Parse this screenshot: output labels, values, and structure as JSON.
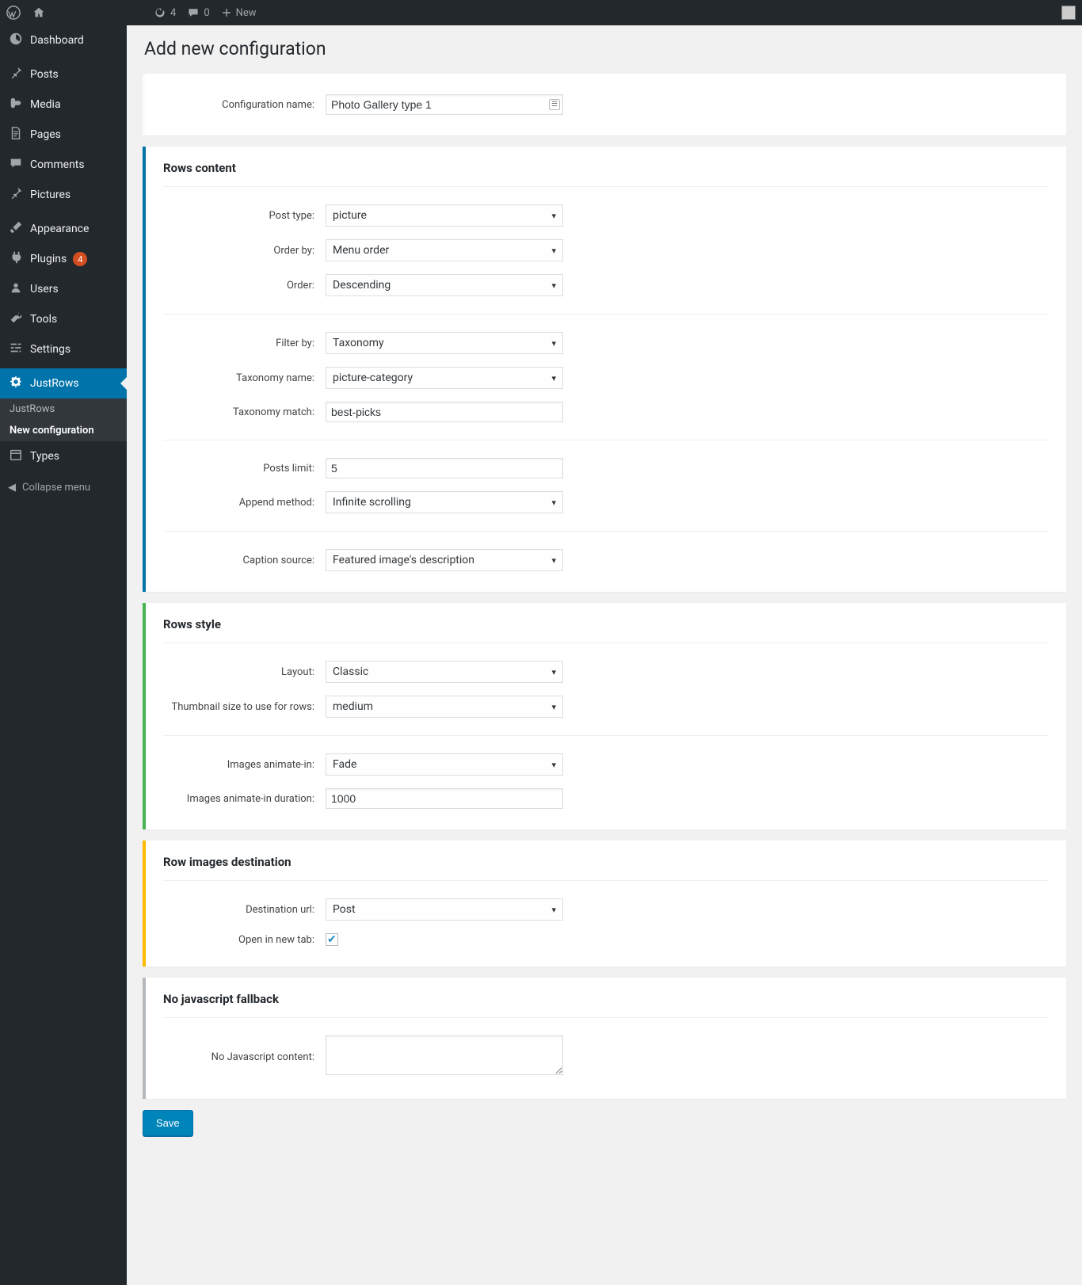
{
  "adminbar": {
    "updates_count": "4",
    "comments_count": "0",
    "new_label": "New"
  },
  "sidebar": {
    "items": [
      {
        "label": "Dashboard"
      },
      {
        "label": "Posts"
      },
      {
        "label": "Media"
      },
      {
        "label": "Pages"
      },
      {
        "label": "Comments"
      },
      {
        "label": "Pictures"
      },
      {
        "label": "Appearance"
      },
      {
        "label": "Plugins",
        "badge": "4"
      },
      {
        "label": "Users"
      },
      {
        "label": "Tools"
      },
      {
        "label": "Settings"
      },
      {
        "label": "JustRows"
      },
      {
        "label": "Types"
      }
    ],
    "submenu": {
      "justrows": "JustRows",
      "newconfig": "New configuration"
    },
    "collapse": "Collapse menu"
  },
  "page": {
    "title": "Add new configuration"
  },
  "config": {
    "name_label": "Configuration name:",
    "name_value": "Photo Gallery type 1"
  },
  "rows_content": {
    "heading": "Rows content",
    "post_type_label": "Post type:",
    "post_type_value": "picture",
    "order_by_label": "Order by:",
    "order_by_value": "Menu order",
    "order_label": "Order:",
    "order_value": "Descending",
    "filter_by_label": "Filter by:",
    "filter_by_value": "Taxonomy",
    "taxonomy_name_label": "Taxonomy name:",
    "taxonomy_name_value": "picture-category",
    "taxonomy_match_label": "Taxonomy match:",
    "taxonomy_match_value": "best-picks",
    "posts_limit_label": "Posts limit:",
    "posts_limit_value": "5",
    "append_method_label": "Append method:",
    "append_method_value": "Infinite scrolling",
    "caption_source_label": "Caption source:",
    "caption_source_value": "Featured image's description"
  },
  "rows_style": {
    "heading": "Rows style",
    "layout_label": "Layout:",
    "layout_value": "Classic",
    "thumb_size_label": "Thumbnail size to use for rows:",
    "thumb_size_value": "medium",
    "animate_in_label": "Images animate-in:",
    "animate_in_value": "Fade",
    "animate_dur_label": "Images animate-in duration:",
    "animate_dur_value": "1000"
  },
  "row_dest": {
    "heading": "Row images destination",
    "dest_url_label": "Destination url:",
    "dest_url_value": "Post",
    "new_tab_label": "Open in new tab:",
    "new_tab_checked": true
  },
  "nojs": {
    "heading": "No javascript fallback",
    "content_label": "No Javascript content:",
    "content_value": ""
  },
  "actions": {
    "save_label": "Save"
  }
}
